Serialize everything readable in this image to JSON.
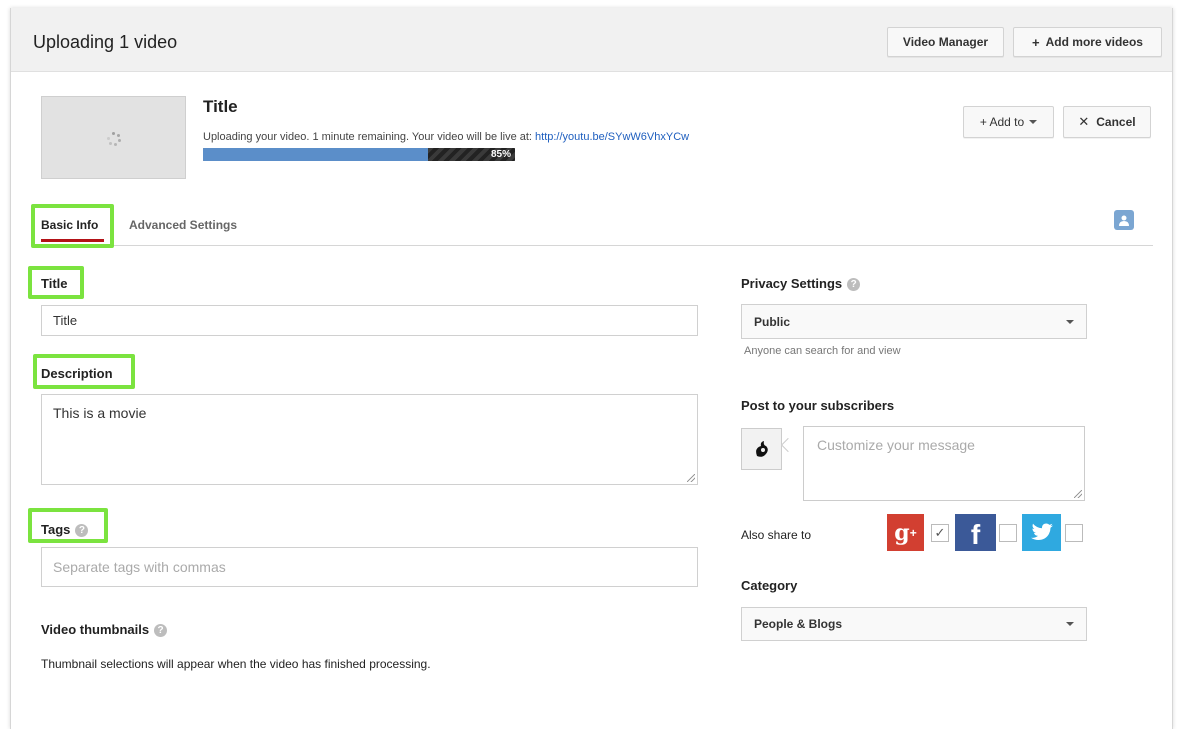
{
  "header": {
    "title": "Uploading 1 video",
    "video_manager_label": "Video Manager",
    "add_more_label": "Add more videos"
  },
  "upload": {
    "title": "Title",
    "status_text": "Uploading your video. 1 minute remaining. Your video will be live at: ",
    "url": "http://youtu.be/SYwW6VhxYCw",
    "progress_label": "85%",
    "progress_fraction": 0.85,
    "add_to_label": "+ Add to",
    "cancel_label": "Cancel"
  },
  "tabs": [
    {
      "label": "Basic Info",
      "active": true
    },
    {
      "label": "Advanced Settings",
      "active": false
    }
  ],
  "form": {
    "title_label": "Title",
    "title_value": "Title",
    "description_label": "Description",
    "description_value": "This is a movie",
    "tags_label": "Tags",
    "tags_placeholder": "Separate tags with commas",
    "thumbnails_label": "Video thumbnails",
    "thumbnails_note": "Thumbnail selections will appear when the video has finished processing."
  },
  "sidebar": {
    "privacy_label": "Privacy Settings",
    "privacy_value": "Public",
    "privacy_hint": "Anyone can search for and view",
    "post_label": "Post to your subscribers",
    "message_placeholder": "Customize your message",
    "share_label": "Also share to",
    "share_targets": [
      {
        "name": "Google+",
        "glyph": "g+",
        "color": "#d23f31",
        "checked": true
      },
      {
        "name": "Facebook",
        "glyph": "f",
        "color": "#3b5998",
        "checked": false
      },
      {
        "name": "Twitter",
        "glyph": "bird",
        "color": "#2fa9e0",
        "checked": false
      }
    ],
    "category_label": "Category",
    "category_value": "People & Blogs"
  },
  "colors": {
    "highlight": "#7be33f",
    "tab_underline": "#b31217",
    "progress": "#5b8ec9",
    "link": "#1f5fbf"
  },
  "icons": [
    "loading-spinner-icon",
    "help-icon",
    "dropdown-caret-icon",
    "close-icon",
    "share-people-icon",
    "google-plus-icon",
    "facebook-icon",
    "twitter-icon",
    "checkmark-icon"
  ]
}
